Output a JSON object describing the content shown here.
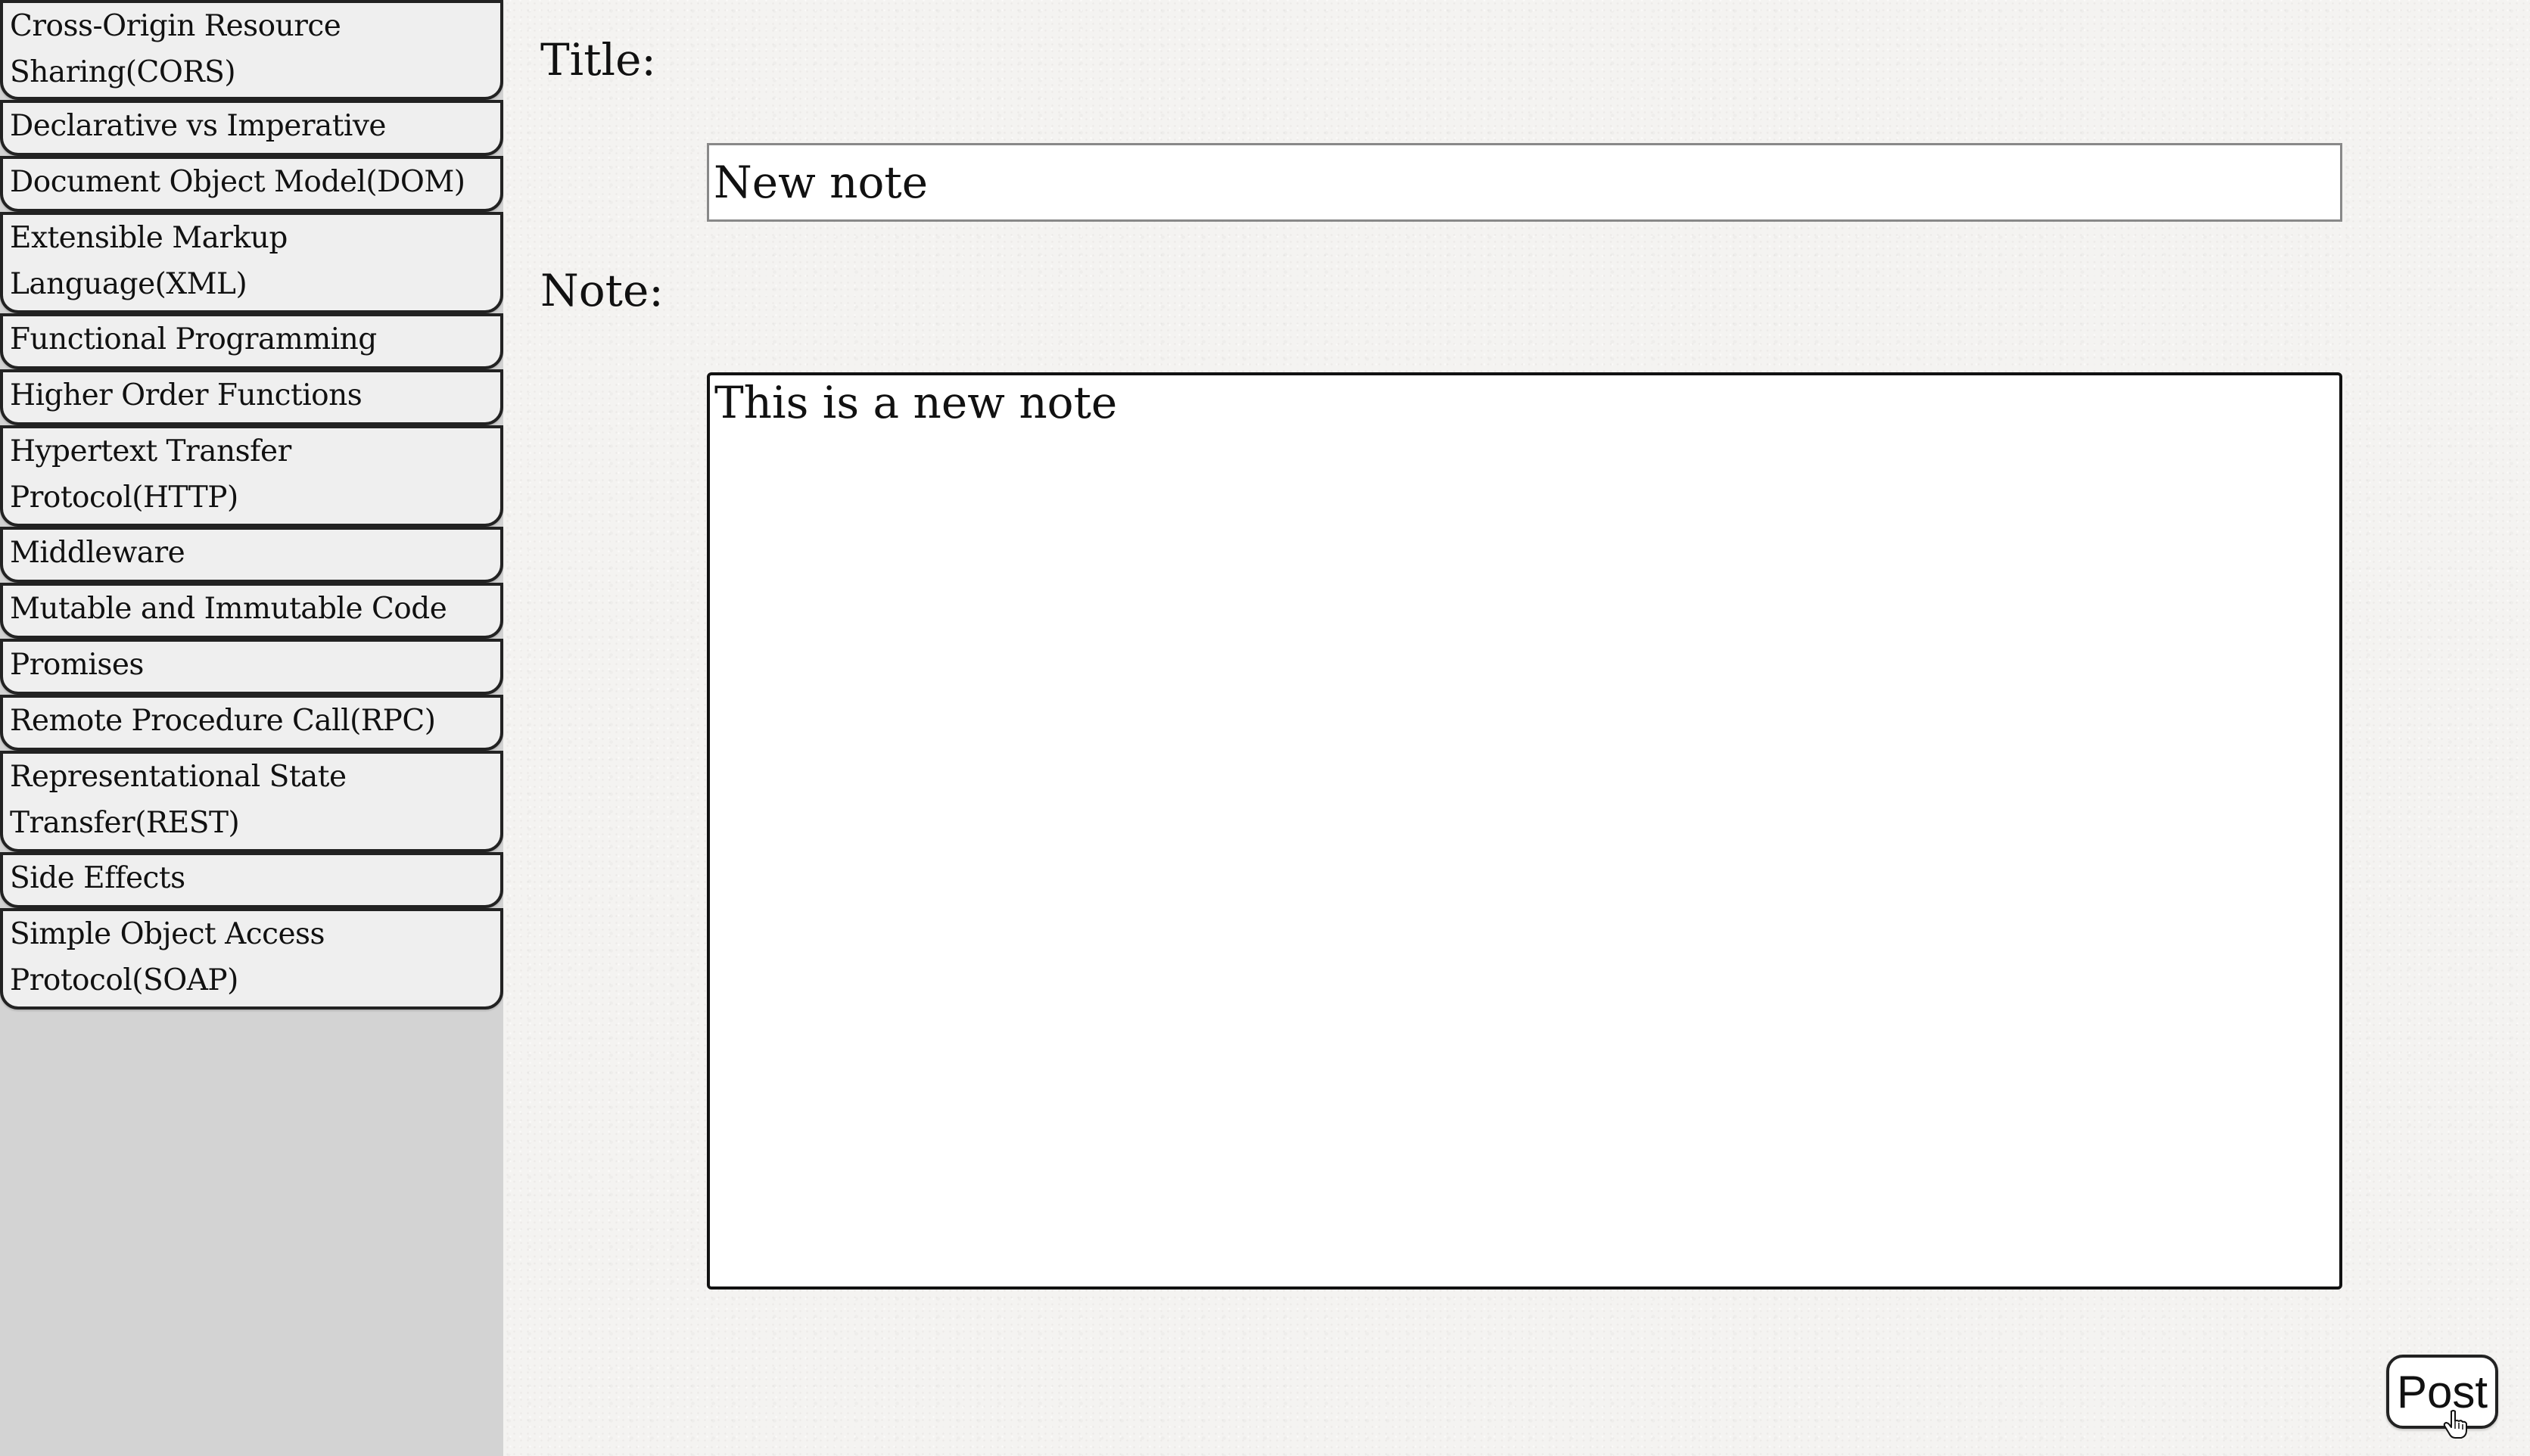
{
  "sidebar": {
    "items": [
      {
        "lines": [
          "Cross-Origin Resource",
          "Sharing(CORS)"
        ]
      },
      {
        "lines": [
          "Declarative vs Imperative"
        ]
      },
      {
        "lines": [
          "Document Object Model(DOM)"
        ]
      },
      {
        "lines": [
          "Extensible Markup",
          "Language(XML)"
        ]
      },
      {
        "lines": [
          "Functional Programming"
        ]
      },
      {
        "lines": [
          "Higher Order Functions"
        ]
      },
      {
        "lines": [
          "Hypertext Transfer",
          "Protocol(HTTP)"
        ]
      },
      {
        "lines": [
          "Middleware"
        ]
      },
      {
        "lines": [
          "Mutable and Immutable Code"
        ]
      },
      {
        "lines": [
          "Promises"
        ]
      },
      {
        "lines": [
          "Remote Procedure Call(RPC)"
        ]
      },
      {
        "lines": [
          "Representational State",
          "Transfer(REST)"
        ]
      },
      {
        "lines": [
          "Side Effects"
        ]
      },
      {
        "lines": [
          "Simple Object Access",
          "Protocol(SOAP)"
        ]
      }
    ]
  },
  "form": {
    "title_label": "Title:",
    "title_value": "New note",
    "note_label": "Note:",
    "note_value": "This is a new note",
    "post_label": "Post"
  },
  "colors": {
    "sidebar_bg": "#d3d3d3",
    "item_bg": "#efefef",
    "border": "#222222"
  },
  "icons": {
    "cursor": "hand-pointer-icon"
  }
}
